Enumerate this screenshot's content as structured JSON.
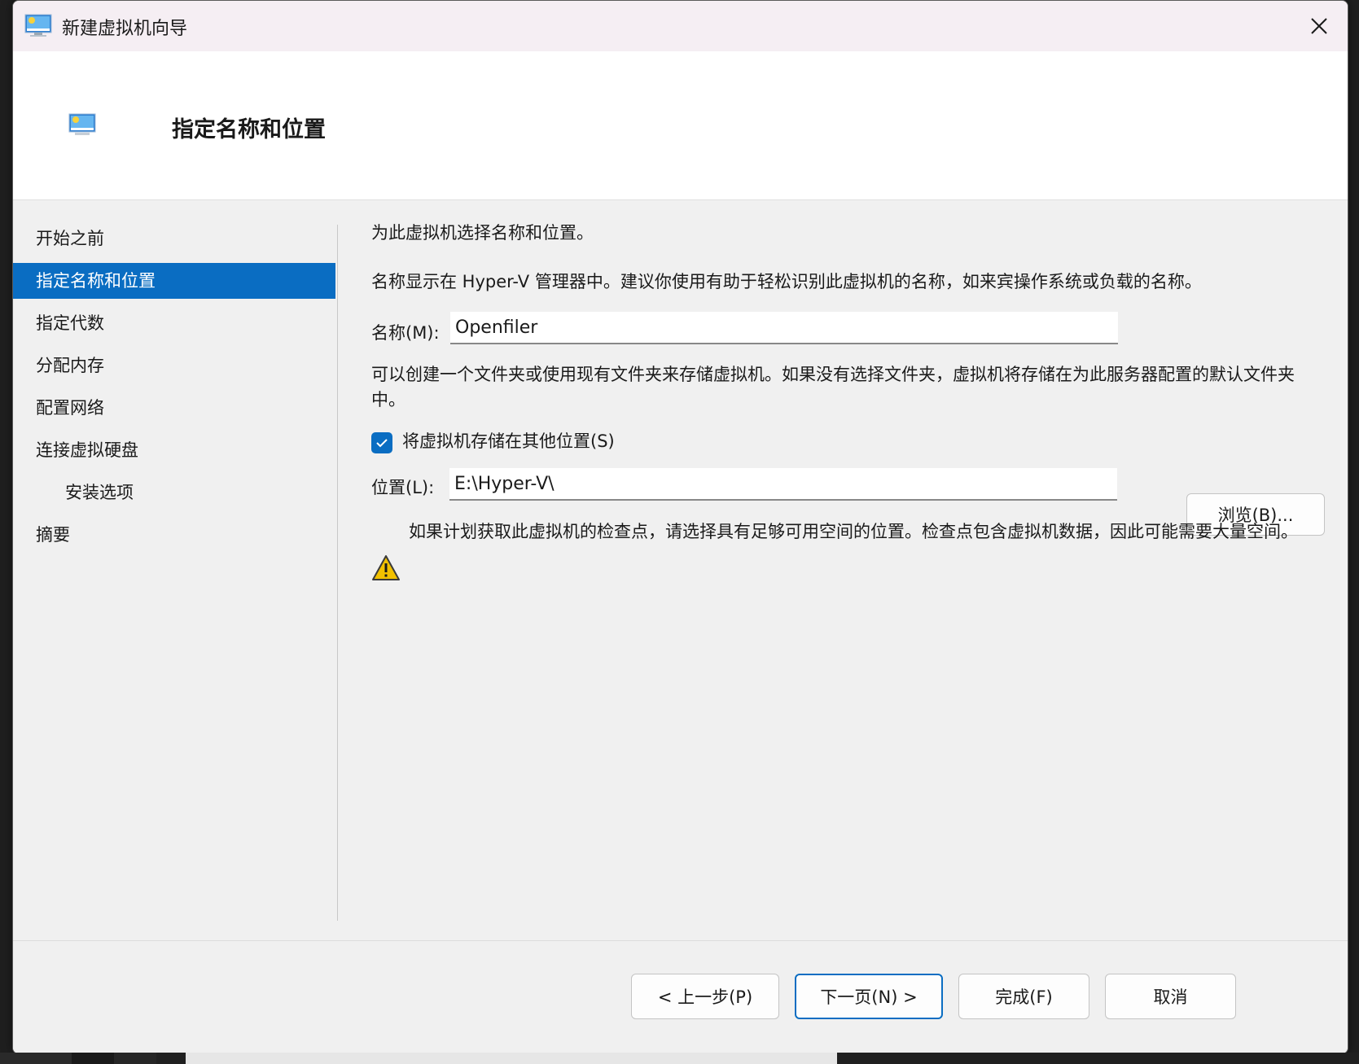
{
  "window": {
    "title": "新建虚拟机向导",
    "close_icon": "close-icon"
  },
  "header": {
    "title": "指定名称和位置"
  },
  "nav": {
    "items": [
      {
        "label": "开始之前",
        "active": false,
        "sub": false
      },
      {
        "label": "指定名称和位置",
        "active": true,
        "sub": false
      },
      {
        "label": "指定代数",
        "active": false,
        "sub": false
      },
      {
        "label": "分配内存",
        "active": false,
        "sub": false
      },
      {
        "label": "配置网络",
        "active": false,
        "sub": false
      },
      {
        "label": "连接虚拟硬盘",
        "active": false,
        "sub": false
      },
      {
        "label": "安装选项",
        "active": false,
        "sub": true
      },
      {
        "label": "摘要",
        "active": false,
        "sub": false
      }
    ]
  },
  "content": {
    "intro": "为此虚拟机选择名称和位置。",
    "name_hint": "名称显示在 Hyper-V 管理器中。建议你使用有助于轻松识别此虚拟机的名称，如来宾操作系统或负载的名称。",
    "name_label": "名称(M):",
    "name_value": "Openfiler",
    "folder_hint": "可以创建一个文件夹或使用现有文件夹来存储虚拟机。如果没有选择文件夹，虚拟机将存储在为此服务器配置的默认文件夹中。",
    "store_elsewhere_label": "将虚拟机存储在其他位置(S)",
    "store_elsewhere_checked": true,
    "location_label": "位置(L):",
    "location_value": "E:\\Hyper-V\\",
    "browse_label": "浏览(B)...",
    "warning": "如果计划获取此虚拟机的检查点，请选择具有足够可用空间的位置。检查点包含虚拟机数据，因此可能需要大量空间。"
  },
  "footer": {
    "back_label": "< 上一步(P)",
    "next_label": "下一页(N) >",
    "finish_label": "完成(F)",
    "cancel_label": "取消"
  },
  "colors": {
    "accent": "#0a6dc2",
    "titlebar": "#f5eef3",
    "warning": "#f2c100"
  }
}
